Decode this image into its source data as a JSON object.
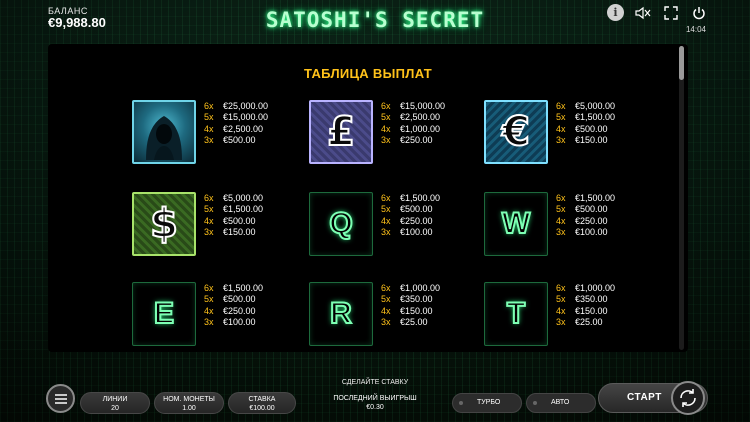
{
  "header": {
    "balance_label": "БАЛАНС",
    "balance_value": "€9,988.80",
    "title": "SATOSHI'S SECRET",
    "clock": "14:04",
    "info_label": "i"
  },
  "paytable": {
    "title": "ТАБЛИЦА ВЫПЛАТ",
    "symbols": [
      {
        "name": "hacker",
        "glyph": "",
        "pays": [
          {
            "mult": "6x",
            "amount": "€25,000.00"
          },
          {
            "mult": "5x",
            "amount": "€15,000.00"
          },
          {
            "mult": "4x",
            "amount": "€2,500.00"
          },
          {
            "mult": "3x",
            "amount": "€500.00"
          }
        ]
      },
      {
        "name": "pound",
        "glyph": "£",
        "pays": [
          {
            "mult": "6x",
            "amount": "€15,000.00"
          },
          {
            "mult": "5x",
            "amount": "€2,500.00"
          },
          {
            "mult": "4x",
            "amount": "€1,000.00"
          },
          {
            "mult": "3x",
            "amount": "€250.00"
          }
        ]
      },
      {
        "name": "euro",
        "glyph": "€",
        "pays": [
          {
            "mult": "6x",
            "amount": "€5,000.00"
          },
          {
            "mult": "5x",
            "amount": "€1,500.00"
          },
          {
            "mult": "4x",
            "amount": "€500.00"
          },
          {
            "mult": "3x",
            "amount": "€150.00"
          }
        ]
      },
      {
        "name": "dollar",
        "glyph": "$",
        "pays": [
          {
            "mult": "6x",
            "amount": "€5,000.00"
          },
          {
            "mult": "5x",
            "amount": "€1,500.00"
          },
          {
            "mult": "4x",
            "amount": "€500.00"
          },
          {
            "mult": "3x",
            "amount": "€150.00"
          }
        ]
      },
      {
        "name": "Q",
        "glyph": "Q",
        "pays": [
          {
            "mult": "6x",
            "amount": "€1,500.00"
          },
          {
            "mult": "5x",
            "amount": "€500.00"
          },
          {
            "mult": "4x",
            "amount": "€250.00"
          },
          {
            "mult": "3x",
            "amount": "€100.00"
          }
        ]
      },
      {
        "name": "W",
        "glyph": "W",
        "pays": [
          {
            "mult": "6x",
            "amount": "€1,500.00"
          },
          {
            "mult": "5x",
            "amount": "€500.00"
          },
          {
            "mult": "4x",
            "amount": "€250.00"
          },
          {
            "mult": "3x",
            "amount": "€100.00"
          }
        ]
      },
      {
        "name": "E",
        "glyph": "E",
        "pays": [
          {
            "mult": "6x",
            "amount": "€1,500.00"
          },
          {
            "mult": "5x",
            "amount": "€500.00"
          },
          {
            "mult": "4x",
            "amount": "€250.00"
          },
          {
            "mult": "3x",
            "amount": "€100.00"
          }
        ]
      },
      {
        "name": "R",
        "glyph": "R",
        "pays": [
          {
            "mult": "6x",
            "amount": "€1,000.00"
          },
          {
            "mult": "5x",
            "amount": "€350.00"
          },
          {
            "mult": "4x",
            "amount": "€150.00"
          },
          {
            "mult": "3x",
            "amount": "€25.00"
          }
        ]
      },
      {
        "name": "T",
        "glyph": "T",
        "pays": [
          {
            "mult": "6x",
            "amount": "€1,000.00"
          },
          {
            "mult": "5x",
            "amount": "€350.00"
          },
          {
            "mult": "4x",
            "amount": "€150.00"
          },
          {
            "mult": "3x",
            "amount": "€25.00"
          }
        ]
      }
    ]
  },
  "controls": {
    "bet_hint": "СДЕЛАЙТЕ СТАВКУ",
    "lines_label": "ЛИНИИ",
    "lines_value": "20",
    "coin_label": "НОМ. МОНЕТЫ",
    "coin_value": "1.00",
    "stake_label": "СТАВКА",
    "stake_value": "€100.00",
    "last_win_label": "ПОСЛЕДНИЙ ВЫИГРЫШ",
    "last_win_value": "€0.30",
    "turbo_label": "ТУРБО",
    "auto_label": "АВТО",
    "start_label": "СТАРТ"
  },
  "colors": {
    "accent": "#ffc21a",
    "neon_green": "#2cff8a"
  }
}
